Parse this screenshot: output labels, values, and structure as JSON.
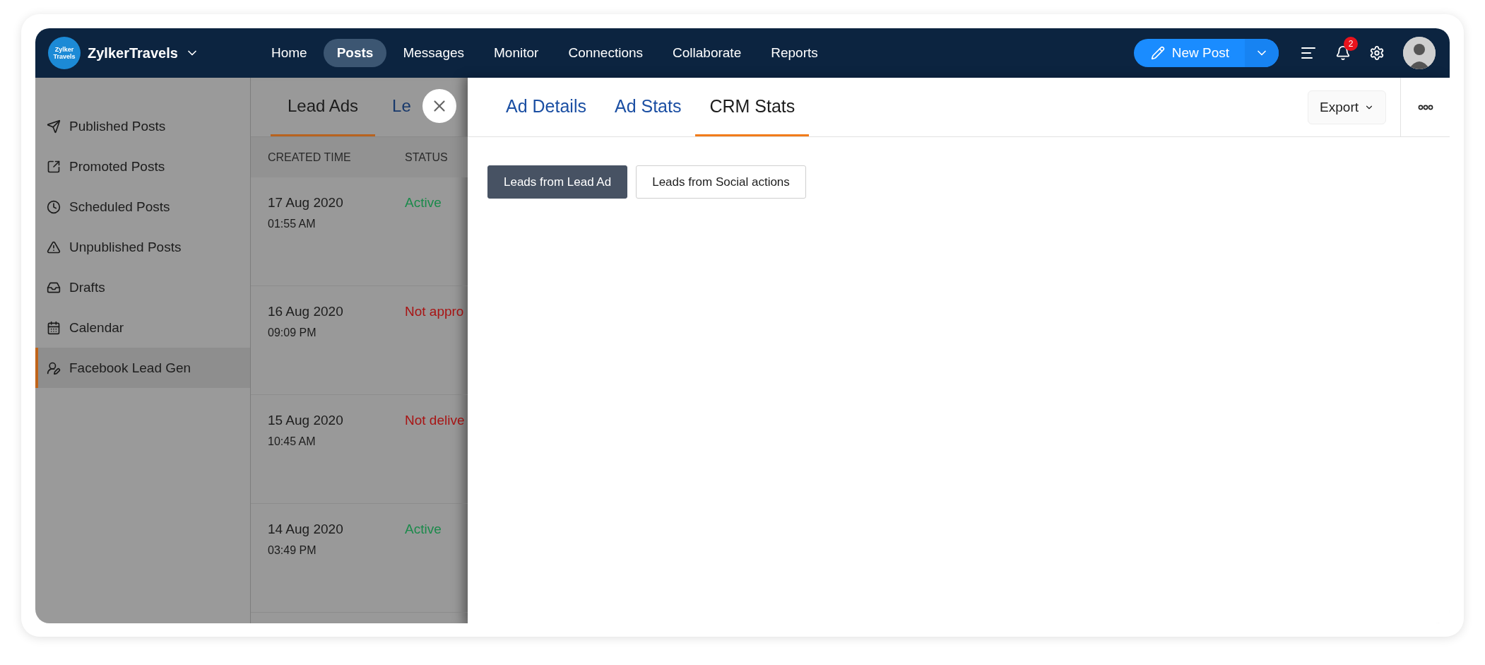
{
  "topbar": {
    "logo": {
      "text": "Zylker Travels"
    },
    "brand": "ZylkerTravels",
    "nav": [
      {
        "label": "Home",
        "selected": false
      },
      {
        "label": "Posts",
        "selected": true
      },
      {
        "label": "Messages",
        "selected": false
      },
      {
        "label": "Monitor",
        "selected": false
      },
      {
        "label": "Connections",
        "selected": false
      },
      {
        "label": "Collaborate",
        "selected": false
      },
      {
        "label": "Reports",
        "selected": false
      }
    ],
    "new_post": "New Post",
    "notifications_badge": "2"
  },
  "sidebar": {
    "items": [
      {
        "label": "Published Posts",
        "selected": false
      },
      {
        "label": "Promoted Posts",
        "selected": false
      },
      {
        "label": "Scheduled Posts",
        "selected": false
      },
      {
        "label": "Unpublished Posts",
        "selected": false
      },
      {
        "label": "Drafts",
        "selected": false
      },
      {
        "label": "Calendar",
        "selected": false
      },
      {
        "label": "Facebook Lead Gen",
        "selected": true
      }
    ]
  },
  "list": {
    "tabs": [
      {
        "label": "Lead Ads",
        "selected": true
      },
      {
        "label": "Le",
        "selected": false
      }
    ],
    "columns": [
      "CREATED TIME",
      "STATUS"
    ],
    "rows": [
      {
        "date": "17 Aug 2020",
        "time": "01:55 AM",
        "status": "Active",
        "kind": "ok"
      },
      {
        "date": "16 Aug 2020",
        "time": "09:09 PM",
        "status": "Not appro",
        "kind": "error"
      },
      {
        "date": "15 Aug 2020",
        "time": "10:45 AM",
        "status": "Not delive",
        "kind": "error"
      },
      {
        "date": "14 Aug 2020",
        "time": "03:49 PM",
        "status": "Active",
        "kind": "ok"
      }
    ]
  },
  "panel": {
    "tabs": [
      {
        "label": "Ad Details",
        "selected": false
      },
      {
        "label": "Ad Stats",
        "selected": false
      },
      {
        "label": "CRM Stats",
        "selected": true
      }
    ],
    "export": "Export",
    "segments": [
      {
        "label": "Leads from Lead Ad",
        "selected": true
      },
      {
        "label": "Leads from Social actions",
        "selected": false
      }
    ]
  }
}
